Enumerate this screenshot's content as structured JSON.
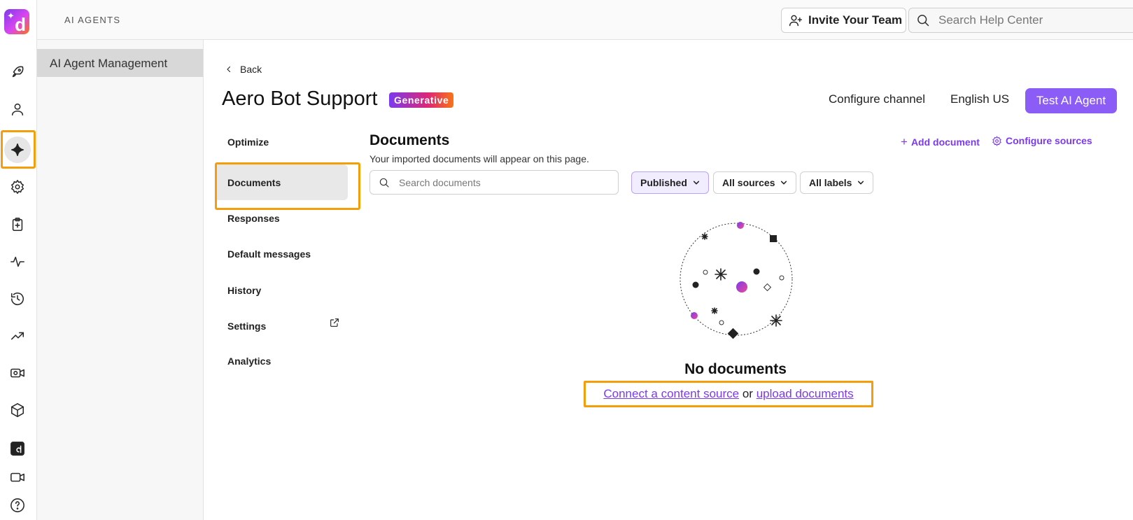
{
  "brand": {
    "logo_letter": "d",
    "accent": "#8b5cf6",
    "highlight": "#f59e0b"
  },
  "rail": {
    "items": [
      {
        "icon": "rocket-icon"
      },
      {
        "icon": "user-icon"
      },
      {
        "icon": "sparkle-icon",
        "active": true
      },
      {
        "icon": "gear-icon"
      },
      {
        "icon": "clipboard-sparkle-icon"
      },
      {
        "icon": "pulse-icon"
      },
      {
        "icon": "history-icon"
      },
      {
        "icon": "trend-up-icon"
      },
      {
        "icon": "video-gear-icon"
      },
      {
        "icon": "cube-icon"
      },
      {
        "icon": "d-app-icon"
      },
      {
        "icon": "camera-icon"
      },
      {
        "icon": "help-icon"
      }
    ]
  },
  "header": {
    "breadcrumb": "AI AGENTS",
    "invite_label": "Invite Your Team",
    "help_search_placeholder": "Search Help Center"
  },
  "subnav": {
    "item": "AI Agent Management"
  },
  "page": {
    "back_label": "Back",
    "title": "Aero Bot Support",
    "badge": "Generative",
    "configure_channel": "Configure channel",
    "language": "English US",
    "test_button": "Test AI Agent"
  },
  "tabs": [
    {
      "label": "Optimize"
    },
    {
      "label": "Documents",
      "active": true
    },
    {
      "label": "Responses"
    },
    {
      "label": "Default messages"
    },
    {
      "label": "History"
    },
    {
      "label": "Settings"
    },
    {
      "label": "Analytics",
      "external": true
    }
  ],
  "documents": {
    "title": "Documents",
    "subtitle": "Your imported documents will appear on this page.",
    "add_document": "Add document",
    "configure_sources": "Configure sources",
    "search_placeholder": "Search documents",
    "filters": {
      "status": "Published",
      "sources": "All sources",
      "labels": "All labels"
    },
    "empty": {
      "title": "No documents",
      "link_connect": "Connect a content source",
      "or": "or",
      "link_upload": "upload documents"
    }
  }
}
